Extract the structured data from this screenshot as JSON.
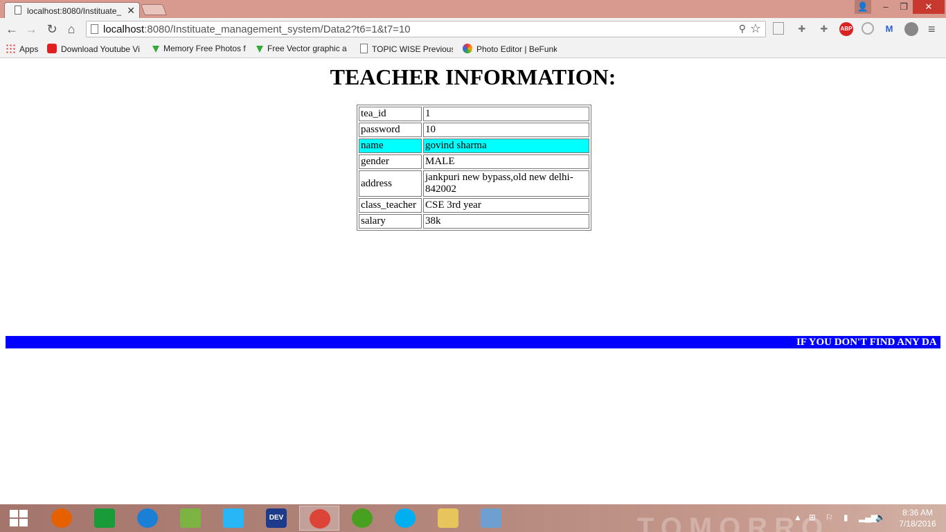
{
  "browser": {
    "tab_title": "localhost:8080/Instituate_",
    "tab_close": "✕",
    "url_host": "localhost",
    "url_path": ":8080/Instituate_management_system/Data2?t6=1&t7=10",
    "window_user": "👤",
    "window_minimize": "‒",
    "window_restore": "❐",
    "window_close": "✕",
    "nav": {
      "back": "←",
      "forward": "→",
      "reload": "↻",
      "home": "⌂"
    },
    "key": "⚲",
    "star": "☆",
    "menu": "≡",
    "abp_label": "ABP",
    "bookmarks": [
      {
        "label": "Apps",
        "icon": "apps-grid-icon"
      },
      {
        "label": "Download Youtube Vi",
        "icon": "youtube-icon"
      },
      {
        "label": "Memory Free Photos f",
        "icon": "download-arrow-icon"
      },
      {
        "label": "Free Vector graphic a",
        "icon": "download-arrow-icon"
      },
      {
        "label": "TOPIC WISE Previous",
        "icon": "page-icon"
      },
      {
        "label": "Photo Editor | BeFunk",
        "icon": "befunky-icon"
      }
    ]
  },
  "page": {
    "heading": "TEACHER INFORMATION:",
    "table": [
      {
        "key": "tea_id",
        "value": "1"
      },
      {
        "key": "password",
        "value": "10"
      },
      {
        "key": "name",
        "value": "govind sharma",
        "highlight": true
      },
      {
        "key": "gender",
        "value": "MALE"
      },
      {
        "key": "address",
        "value": "jankpuri new bypass,old new delhi-842002"
      },
      {
        "key": "class_teacher",
        "value": "CSE 3rd year"
      },
      {
        "key": "salary",
        "value": "38k"
      }
    ],
    "marquee_text": "IF YOU DON'T FIND ANY DA"
  },
  "taskbar": {
    "wallpaper_text": "TOMORROW",
    "apps": [
      "firefox-icon",
      "store-icon",
      "internet-explorer-icon",
      "android-studio-icon",
      "shareit-icon",
      "devcpp-icon",
      "chrome-icon",
      "utorrent-icon",
      "skype-icon",
      "file-explorer-icon",
      "virtualbox-icon"
    ],
    "app_colors": [
      "#e66000",
      "#1a9b3a",
      "#1b7fd6",
      "#7cb342",
      "#29b6f6",
      "#1e3a8a",
      "#db4437",
      "#48a020",
      "#00aff0",
      "#e8c45c",
      "#6e9fd0"
    ],
    "dev_label": "DEV",
    "time": "8:36 AM",
    "date": "7/18/2016"
  }
}
